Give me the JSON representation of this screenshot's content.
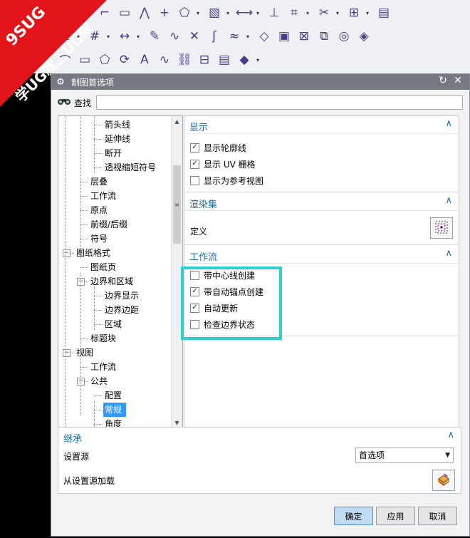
{
  "watermark": {
    "line1": "9SUG",
    "line2": "学UG就上UG网"
  },
  "toolbar": {
    "row1": [
      "arc-icon",
      "circle-icon",
      "fillet-icon",
      "rectangle-icon",
      "polyline-icon",
      "point-icon",
      "shape-icon",
      "drop",
      "hatch-icon",
      "drop",
      "dimension-icon",
      "drop",
      "constraint-icon",
      "projection-icon",
      "drop",
      "trim-icon",
      "drop",
      "view-icon",
      "drop",
      "book-icon"
    ],
    "row2": [
      "constraint-icon",
      "drop",
      "grid-icon",
      "drop",
      "measure-icon",
      "drop",
      "paint-icon",
      "curve-icon",
      "cross-icon",
      "spline-icon",
      "wave-icon",
      "drop",
      "surface-icon",
      "patch-icon",
      "mesh-icon",
      "net-icon",
      "tube-icon",
      "solid-icon"
    ],
    "row3": [
      "arc-icon",
      "rectangle-icon",
      "shape-icon",
      "offset-icon",
      "text-icon",
      "curve-icon",
      "link-icon",
      "stack-icon",
      "book-icon",
      "layer-icon",
      "drop"
    ]
  },
  "dialog": {
    "title": "制图首选项",
    "search_label": "查找",
    "search_value": "",
    "tree": [
      {
        "label": "箭头线",
        "level": 3,
        "expander": "",
        "selected": false
      },
      {
        "label": "延伸线",
        "level": 3,
        "expander": "",
        "selected": false
      },
      {
        "label": "断开",
        "level": 3,
        "expander": "",
        "selected": false
      },
      {
        "label": "透视缩短符号",
        "level": 3,
        "expander": "",
        "selected": false
      },
      {
        "label": "层叠",
        "level": 2,
        "expander": "",
        "selected": false
      },
      {
        "label": "工作流",
        "level": 2,
        "expander": "",
        "selected": false
      },
      {
        "label": "原点",
        "level": 2,
        "expander": "",
        "selected": false
      },
      {
        "label": "前缀/后缀",
        "level": 2,
        "expander": "",
        "selected": false
      },
      {
        "label": "符号",
        "level": 2,
        "expander": "",
        "selected": false
      },
      {
        "label": "图纸格式",
        "level": 1,
        "expander": "−",
        "selected": false
      },
      {
        "label": "图纸页",
        "level": 2,
        "expander": "",
        "selected": false
      },
      {
        "label": "边界和区域",
        "level": 2,
        "expander": "−",
        "selected": false
      },
      {
        "label": "边界显示",
        "level": 3,
        "expander": "",
        "selected": false
      },
      {
        "label": "边界边距",
        "level": 3,
        "expander": "",
        "selected": false
      },
      {
        "label": "区域",
        "level": 3,
        "expander": "",
        "selected": false
      },
      {
        "label": "标题块",
        "level": 2,
        "expander": "",
        "selected": false
      },
      {
        "label": "视图",
        "level": 1,
        "expander": "−",
        "selected": false
      },
      {
        "label": "工作流",
        "level": 2,
        "expander": "",
        "selected": false
      },
      {
        "label": "公共",
        "level": 2,
        "expander": "−",
        "selected": false
      },
      {
        "label": "配置",
        "level": 3,
        "expander": "",
        "selected": false
      },
      {
        "label": "常规",
        "level": 3,
        "expander": "",
        "selected": true
      },
      {
        "label": "角度",
        "level": 3,
        "expander": "",
        "selected": false
      }
    ],
    "display": {
      "title": "显示",
      "options": [
        {
          "label": "显示轮廓线",
          "checked": true,
          "mark": "✓"
        },
        {
          "label": "显示 UV 栅格",
          "checked": true,
          "mark": "✓"
        },
        {
          "label": "显示为参考视图",
          "checked": false,
          "mark": ""
        }
      ]
    },
    "render": {
      "title": "渲染集",
      "define_label": "定义"
    },
    "workflow": {
      "title": "工作流",
      "options": [
        {
          "label": "带中心线创建",
          "checked": false,
          "mark": ""
        },
        {
          "label": "带自动锚点创建",
          "checked": true,
          "mark": "✓"
        },
        {
          "label": "自动更新",
          "checked": true,
          "mark": "✓"
        },
        {
          "label": "检查边界状态",
          "checked": false,
          "mark": ""
        }
      ]
    },
    "inherit": {
      "title": "继承",
      "source_label": "设置源",
      "source_value": "首选项",
      "load_label": "从设置源加载"
    },
    "buttons": {
      "ok": "确定",
      "apply": "应用",
      "cancel": "取消"
    },
    "caret": "∧"
  }
}
